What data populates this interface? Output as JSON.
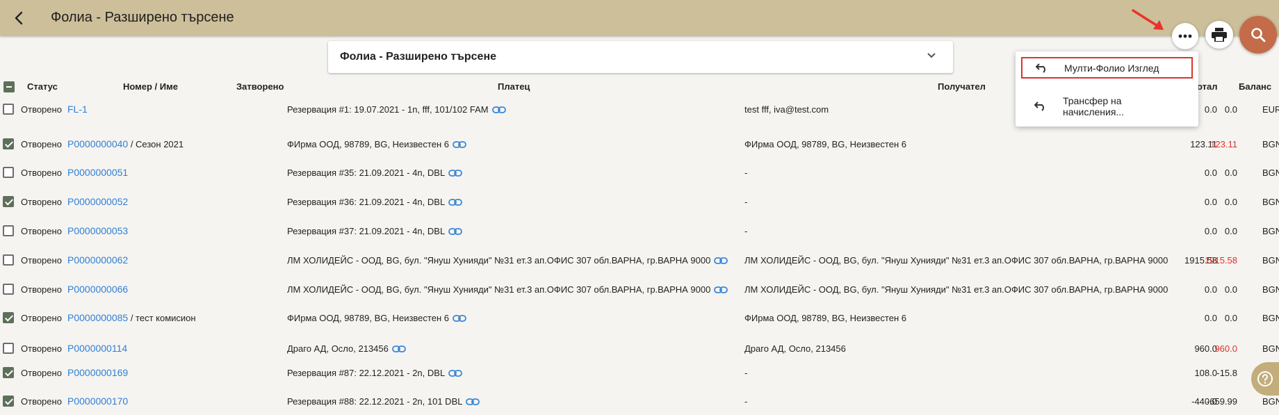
{
  "app": {
    "title": "Фолиа - Разширено търсене"
  },
  "panel": {
    "title": "Фолиа - Разширено търсене"
  },
  "menu": {
    "items": [
      "Мулти-Фолио Изглед",
      "Трансфер на начисления..."
    ]
  },
  "columns": {
    "status": "Статус",
    "number": "Номер / Име",
    "closed": "Затворено",
    "payer": "Платец",
    "recipient": "Получател",
    "total": "отал",
    "balance": "Баланс"
  },
  "rows": [
    {
      "checked": false,
      "status": "Отворено",
      "number": "FL-1",
      "name": "",
      "payer": "Резервация #1: 19.07.2021 - 1n,        fff, 101/102 FAM",
      "payer_link": true,
      "recipient": "test fff, iva@test.com",
      "total": "0.0",
      "balance": "0.0",
      "balance_negative": false,
      "currency": "EUR"
    },
    {
      "checked": true,
      "status": "Отворено",
      "number": "P0000000040",
      "name": " / Сезон 2021",
      "payer": "ФИрма ООД, 98789, BG, Неизвестен 6",
      "payer_link": true,
      "recipient": "ФИрма ООД, 98789, BG, Неизвестен 6",
      "total": "123.11",
      "balance": "123.11",
      "balance_negative": true,
      "currency": "BGN"
    },
    {
      "checked": false,
      "status": "Отворено",
      "number": "P0000000051",
      "name": "",
      "payer": "Резервация #35: 21.09.2021 - 4n, DBL",
      "payer_link": true,
      "recipient": "-",
      "total": "0.0",
      "balance": "0.0",
      "balance_negative": false,
      "currency": "BGN"
    },
    {
      "checked": true,
      "status": "Отворено",
      "number": "P0000000052",
      "name": "",
      "payer": "Резервация #36: 21.09.2021 - 4n, DBL",
      "payer_link": true,
      "recipient": "-",
      "total": "0.0",
      "balance": "0.0",
      "balance_negative": false,
      "currency": "BGN"
    },
    {
      "checked": false,
      "status": "Отворено",
      "number": "P0000000053",
      "name": "",
      "payer": "Резервация #37: 21.09.2021 - 4n, DBL",
      "payer_link": true,
      "recipient": "-",
      "total": "0.0",
      "balance": "0.0",
      "balance_negative": false,
      "currency": "BGN"
    },
    {
      "checked": false,
      "status": "Отворено",
      "number": "P0000000062",
      "name": "",
      "payer": "ЛМ ХОЛИДЕЙС - ООД, BG, бул. \"Януш Хунияди\" №31 ет.3 ап.ОФИС 307 обл.ВАРНА, гр.ВАРНА 9000",
      "payer_link": true,
      "recipient": "ЛМ ХОЛИДЕЙС - ООД, BG, бул. \"Януш Хунияди\" №31 ет.3 ап.ОФИС 307 обл.ВАРНА, гр.ВАРНА 9000",
      "total": "1915.58",
      "balance": "1915.58",
      "balance_negative": true,
      "currency": "BGN"
    },
    {
      "checked": false,
      "status": "Отворено",
      "number": "P0000000066",
      "name": "",
      "payer": "ЛМ ХОЛИДЕЙС - ООД, BG, бул. \"Януш Хунияди\" №31 ет.3 ап.ОФИС 307 обл.ВАРНА, гр.ВАРНА 9000",
      "payer_link": true,
      "recipient": "ЛМ ХОЛИДЕЙС - ООД, BG, бул. \"Януш Хунияди\" №31 ет.3 ап.ОФИС 307 обл.ВАРНА, гр.ВАРНА 9000",
      "total": "0.0",
      "balance": "0.0",
      "balance_negative": false,
      "currency": "BGN"
    },
    {
      "checked": true,
      "status": "Отворено",
      "number": "P0000000085",
      "name": " / тест комисион",
      "payer": "ФИрма ООД, 98789, BG, Неизвестен 6",
      "payer_link": true,
      "recipient": "ФИрма ООД, 98789, BG, Неизвестен 6",
      "total": "0.0",
      "balance": "0.0",
      "balance_negative": false,
      "currency": "BGN"
    },
    {
      "checked": false,
      "status": "Отворено",
      "number": "P0000000114",
      "name": "",
      "payer": "Драго АД, Осло, 213456",
      "payer_link": true,
      "recipient": "Драго АД, Осло, 213456",
      "total": "960.0",
      "balance": "960.0",
      "balance_negative": true,
      "currency": "BGN"
    },
    {
      "checked": true,
      "status": "Отворено",
      "number": "P0000000169",
      "name": "",
      "payer": "Резервация #87: 22.12.2021 - 2n, DBL",
      "payer_link": true,
      "recipient": "-",
      "total": "108.0",
      "balance": "-15.8",
      "balance_negative": false,
      "currency": ""
    },
    {
      "checked": true,
      "status": "Отворено",
      "number": "P0000000170",
      "name": "",
      "payer": "Резервация #88: 22.12.2021 - 2n, 101 DBL",
      "payer_link": true,
      "recipient": "-",
      "total": "-440.0",
      "balance": "-659.99",
      "balance_negative": false,
      "currency": "BGN"
    }
  ],
  "colors": {
    "topbar": "#cdbf9a",
    "accent": "#c46b49",
    "link": "#2f7fd6",
    "negative": "#e0302a",
    "check": "#5e6f5a"
  },
  "icons": [
    "back-arrow-icon",
    "chevron-down-icon",
    "more-horiz-icon",
    "print-icon",
    "search-icon",
    "undo-icon",
    "link-icon",
    "help-icon"
  ]
}
